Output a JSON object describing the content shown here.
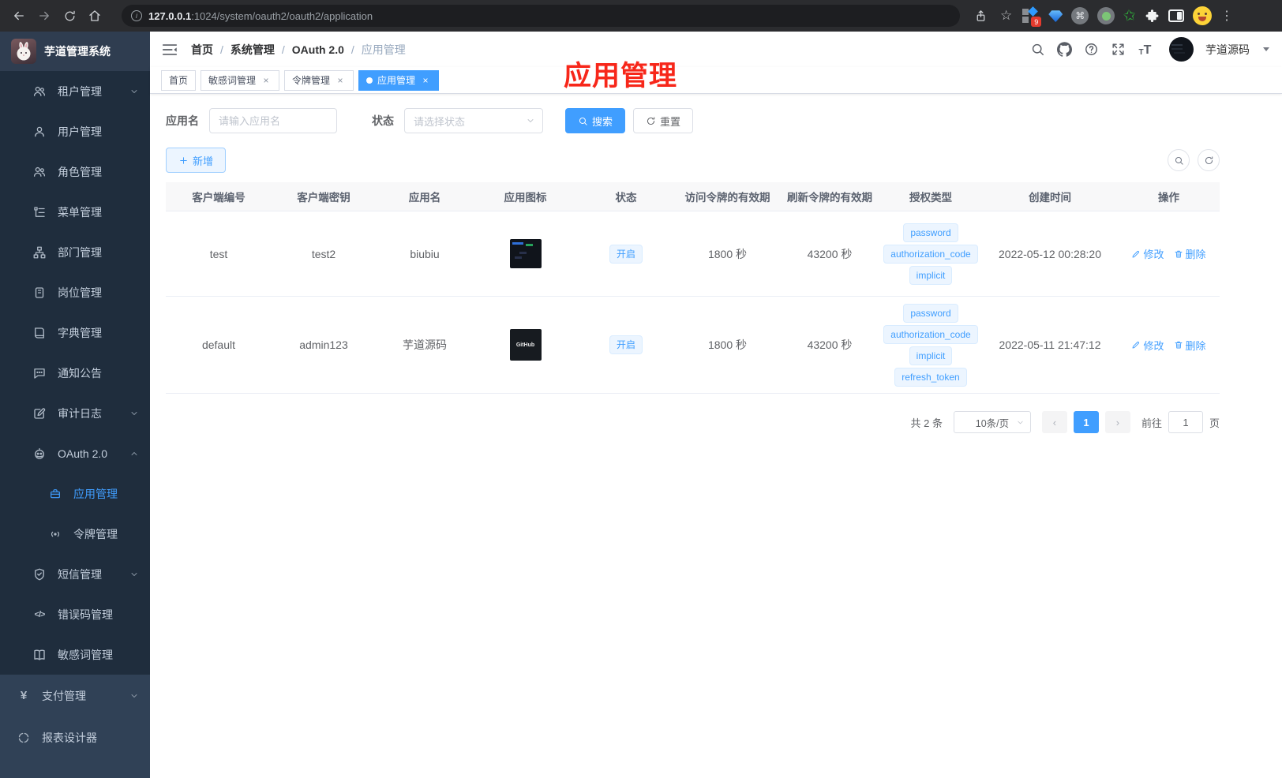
{
  "browser": {
    "url_host": "127.0.0.1",
    "url_path": ":1024/system/oauth2/oauth2/application",
    "extension_badge": "9"
  },
  "sidebar": {
    "logo_title": "芋道管理系统",
    "items": [
      {
        "label": "租户管理"
      },
      {
        "label": "用户管理"
      },
      {
        "label": "角色管理"
      },
      {
        "label": "菜单管理"
      },
      {
        "label": "部门管理"
      },
      {
        "label": "岗位管理"
      },
      {
        "label": "字典管理"
      },
      {
        "label": "通知公告"
      },
      {
        "label": "审计日志"
      },
      {
        "label": "OAuth 2.0"
      },
      {
        "label": "应用管理"
      },
      {
        "label": "令牌管理"
      },
      {
        "label": "短信管理"
      },
      {
        "label": "错误码管理"
      },
      {
        "label": "敏感词管理"
      },
      {
        "label": "支付管理"
      },
      {
        "label": "报表设计器"
      }
    ]
  },
  "header": {
    "breadcrumb": [
      "首页",
      "系统管理",
      "OAuth 2.0",
      "应用管理"
    ],
    "username": "芋道源码"
  },
  "annotation": "应用管理",
  "tabs": [
    {
      "label": "首页"
    },
    {
      "label": "敏感词管理"
    },
    {
      "label": "令牌管理"
    },
    {
      "label": "应用管理"
    }
  ],
  "filters": {
    "name_label": "应用名",
    "name_placeholder": "请输入应用名",
    "status_label": "状态",
    "status_placeholder": "请选择状态",
    "search_label": "搜索",
    "reset_label": "重置",
    "add_label": "新增"
  },
  "table": {
    "headers": [
      "客户端编号",
      "客户端密钥",
      "应用名",
      "应用图标",
      "状态",
      "访问令牌的有效期",
      "刷新令牌的有效期",
      "授权类型",
      "创建时间",
      "操作"
    ],
    "rows": [
      {
        "client_id": "test",
        "secret": "test2",
        "name": "biubiu",
        "icon_label": "",
        "status": "开启",
        "access_ttl": "1800 秒",
        "refresh_ttl": "43200 秒",
        "grants": [
          "password",
          "authorization_code",
          "implicit"
        ],
        "created": "2022-05-12 00:28:20"
      },
      {
        "client_id": "default",
        "secret": "admin123",
        "name": "芋道源码",
        "icon_label": "GitHub",
        "status": "开启",
        "access_ttl": "1800 秒",
        "refresh_ttl": "43200 秒",
        "grants": [
          "password",
          "authorization_code",
          "implicit",
          "refresh_token"
        ],
        "created": "2022-05-11 21:47:12"
      }
    ]
  },
  "actions": {
    "edit": "修改",
    "delete": "删除"
  },
  "pagination": {
    "total": "共 2 条",
    "page_size": "10条/页",
    "current_page": "1",
    "goto_label": "前往",
    "goto_value": "1",
    "page_unit": "页"
  }
}
